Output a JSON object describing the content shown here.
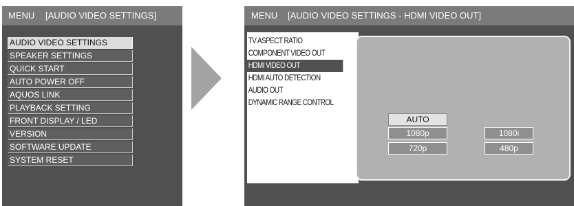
{
  "left_panel": {
    "title": {
      "menu": "MENU",
      "section": "[AUDIO VIDEO SETTINGS]"
    },
    "items": [
      {
        "label": "AUDIO VIDEO SETTINGS",
        "selected": true
      },
      {
        "label": "SPEAKER SETTINGS"
      },
      {
        "label": "QUICK START"
      },
      {
        "label": "AUTO POWER OFF"
      },
      {
        "label": "AQUOS LINK"
      },
      {
        "label": "PLAYBACK SETTING"
      },
      {
        "label": "FRONT DISPLAY / LED"
      },
      {
        "label": "VERSION"
      },
      {
        "label": "SOFTWARE UPDATE"
      },
      {
        "label": "SYSTEM RESET"
      }
    ]
  },
  "right_panel": {
    "title": {
      "menu": "MENU",
      "section": "[AUDIO VIDEO SETTINGS - HDMI VIDEO OUT]"
    },
    "items": [
      {
        "label": "TV ASPECT RATIO"
      },
      {
        "label": "COMPONENT VIDEO OUT"
      },
      {
        "label": "HDMI VIDEO OUT",
        "selected": true
      },
      {
        "label": "HDMI AUTO DETECTION"
      },
      {
        "label": "AUDIO OUT"
      },
      {
        "label": "DYNAMIC RANGE CONTROL"
      }
    ],
    "options": {
      "auto": "AUTO",
      "p1080": "1080p",
      "i1080": "1080i",
      "p720": "720p",
      "p480": "480p",
      "selected": "AUTO"
    }
  },
  "colors": {
    "panel_bg": "#505050",
    "titlebar_bg": "#7b7b7b",
    "selected_item_bg": "#dcdcdc",
    "option_bg": "#8f8f8f",
    "option_selected_bg": "#e3e3e3",
    "detail_bg": "#b1b1b1",
    "arrow": "#a3a3a3"
  }
}
